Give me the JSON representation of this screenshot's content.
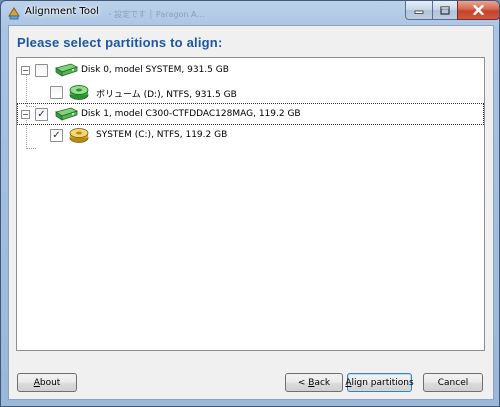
{
  "window": {
    "title": "Alignment Tool",
    "background_ghost_text": "・設定です │ Paragon A…"
  },
  "heading": "Please select partitions to align:",
  "tree": [
    {
      "kind": "disk",
      "expanded": true,
      "checked": false,
      "label": "Disk 0, model SYSTEM, 931.5 GB",
      "icon": "disk-icon"
    },
    {
      "kind": "partition",
      "checked": false,
      "label": "ボリューム (D:), NTFS, 931.5 GB",
      "icon": "partition-icon",
      "icon_color": "#3cb44a"
    },
    {
      "kind": "disk",
      "expanded": true,
      "checked": true,
      "label": "Disk 1, model C300-CTFDDAC128MAG, 119.2 GB",
      "icon": "disk-icon",
      "selected": true
    },
    {
      "kind": "partition",
      "checked": true,
      "label": "SYSTEM (C:), NTFS, 119.2 GB",
      "icon": "partition-icon",
      "icon_color": "#e0b72f"
    }
  ],
  "buttons": {
    "about": {
      "accel": "A",
      "rest": "bout"
    },
    "back": {
      "prefix": "< ",
      "accel": "B",
      "rest": "ack"
    },
    "align": {
      "accel": "A",
      "rest": "lign partitions"
    },
    "cancel": {
      "label": "Cancel"
    }
  },
  "colors": {
    "heading": "#1c57a5",
    "disk_icon": "#3cb44a",
    "system_partition_icon": "#e0b72f"
  }
}
